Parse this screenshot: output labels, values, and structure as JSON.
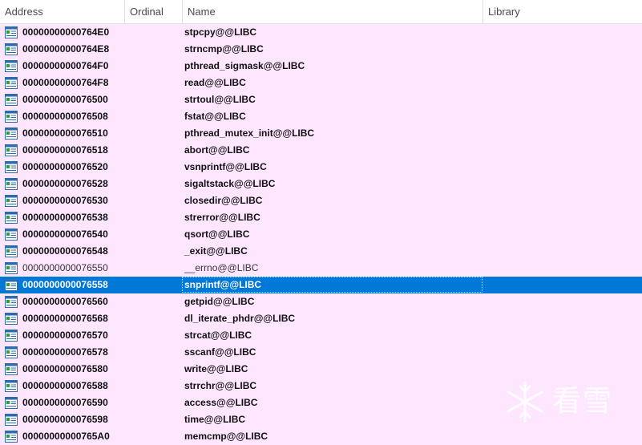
{
  "columns": [
    {
      "label": "Address"
    },
    {
      "label": "Ordinal"
    },
    {
      "label": "Name"
    },
    {
      "label": "Library"
    }
  ],
  "rows": [
    {
      "address": "00000000000764E0",
      "name": "stpcpy@@LIBC",
      "icon": "function-icon"
    },
    {
      "address": "00000000000764E8",
      "name": "strncmp@@LIBC",
      "icon": "function-icon"
    },
    {
      "address": "00000000000764F0",
      "name": "pthread_sigmask@@LIBC",
      "icon": "function-icon"
    },
    {
      "address": "00000000000764F8",
      "name": "read@@LIBC",
      "icon": "function-icon"
    },
    {
      "address": "0000000000076500",
      "name": "strtoul@@LIBC",
      "icon": "function-icon"
    },
    {
      "address": "0000000000076508",
      "name": "fstat@@LIBC",
      "icon": "function-icon"
    },
    {
      "address": "0000000000076510",
      "name": "pthread_mutex_init@@LIBC",
      "icon": "function-icon"
    },
    {
      "address": "0000000000076518",
      "name": "abort@@LIBC",
      "icon": "function-icon"
    },
    {
      "address": "0000000000076520",
      "name": "vsnprintf@@LIBC",
      "icon": "function-icon"
    },
    {
      "address": "0000000000076528",
      "name": "sigaltstack@@LIBC",
      "icon": "function-icon"
    },
    {
      "address": "0000000000076530",
      "name": "closedir@@LIBC",
      "icon": "function-icon"
    },
    {
      "address": "0000000000076538",
      "name": "strerror@@LIBC",
      "icon": "function-icon"
    },
    {
      "address": "0000000000076540",
      "name": "qsort@@LIBC",
      "icon": "function-icon"
    },
    {
      "address": "0000000000076548",
      "name": "_exit@@LIBC",
      "icon": "function-icon"
    },
    {
      "address": "0000000000076550",
      "name": "__errno@@LIBC",
      "icon": "function-icon",
      "style": "normal"
    },
    {
      "address": "0000000000076558",
      "name": "snprintf@@LIBC",
      "icon": "function-icon",
      "selected": true
    },
    {
      "address": "0000000000076560",
      "name": "getpid@@LIBC",
      "icon": "function-icon"
    },
    {
      "address": "0000000000076568",
      "name": "dl_iterate_phdr@@LIBC",
      "icon": "function-icon"
    },
    {
      "address": "0000000000076570",
      "name": "strcat@@LIBC",
      "icon": "function-icon"
    },
    {
      "address": "0000000000076578",
      "name": "sscanf@@LIBC",
      "icon": "function-icon"
    },
    {
      "address": "0000000000076580",
      "name": "write@@LIBC",
      "icon": "function-icon"
    },
    {
      "address": "0000000000076588",
      "name": "strrchr@@LIBC",
      "icon": "function-icon"
    },
    {
      "address": "0000000000076590",
      "name": "access@@LIBC",
      "icon": "function-icon"
    },
    {
      "address": "0000000000076598",
      "name": "time@@LIBC",
      "icon": "function-icon"
    },
    {
      "address": "00000000000765A0",
      "name": "memcmp@@LIBC",
      "icon": "function-icon"
    }
  ],
  "watermark": {
    "text": "看雪",
    "icon": "snowflake-icon"
  },
  "colors": {
    "row_bg": "#ffe6ff",
    "selected_bg": "#0078d7"
  }
}
